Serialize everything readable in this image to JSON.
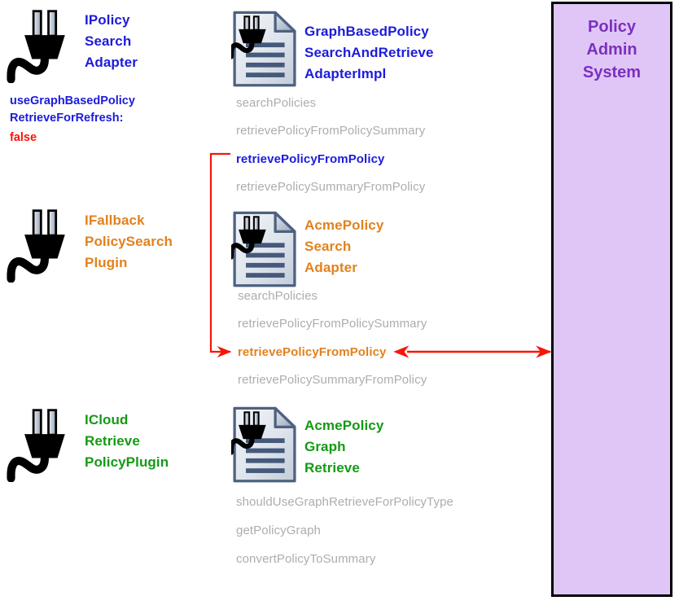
{
  "diagram": {
    "title_text": "Policy Admin System",
    "accent_colors": {
      "blue": "#1c1cdb",
      "orange": "#e2811d",
      "green": "#149a14",
      "gray": "#adadad",
      "red": "#fa1405",
      "purple_text": "#7b2fbe",
      "purple_fill": "#e0c6f7"
    }
  },
  "interfaces": [
    {
      "name": "IPolicy\nSearch\nAdapter",
      "icon": "plug-icon",
      "color": "blue",
      "property_label": "useGraphBasedPolicy\nRetrieveForRefresh:",
      "property_value": "false"
    },
    {
      "name": "IFallback\nPolicySearch\nPlugin",
      "icon": "plug-icon",
      "color": "orange"
    },
    {
      "name": "ICloud\nRetrieve\nPolicyPlugin",
      "icon": "plug-icon",
      "color": "green"
    }
  ],
  "implementations": [
    {
      "name": "GraphBasedPolicy\nSearchAndRetrieve\nAdapterImpl",
      "icon": "document-plug-icon",
      "color": "blue",
      "methods": [
        {
          "label": "searchPolicies",
          "highlight": "none"
        },
        {
          "label": "retrievePolicyFromPolicySummary",
          "highlight": "none"
        },
        {
          "label": "retrievePolicyFromPolicy",
          "highlight": "blue"
        },
        {
          "label": "retrievePolicySummaryFromPolicy",
          "highlight": "none"
        }
      ]
    },
    {
      "name": "AcmePolicy\nSearch\nAdapter",
      "icon": "document-plug-icon",
      "color": "orange",
      "methods": [
        {
          "label": "searchPolicies",
          "highlight": "none"
        },
        {
          "label": "retrievePolicyFromPolicySummary",
          "highlight": "none"
        },
        {
          "label": "retrievePolicyFromPolicy",
          "highlight": "orange"
        },
        {
          "label": "retrievePolicySummaryFromPolicy",
          "highlight": "none"
        }
      ]
    },
    {
      "name": "AcmePolicy\nGraph\nRetrieve",
      "icon": "document-plug-icon",
      "color": "green",
      "methods": [
        {
          "label": "shouldUseGraphRetrieveForPolicyType",
          "highlight": "none"
        },
        {
          "label": "getPolicyGraph",
          "highlight": "none"
        },
        {
          "label": "convertPolicyToSummary",
          "highlight": "none"
        }
      ]
    }
  ],
  "system": {
    "label": "Policy\nAdmin\nSystem"
  },
  "connectors": [
    {
      "name": "delegation-connector",
      "from": "retrievePolicyFromPolicy (GraphBasedPolicySearchAndRetrieveAdapterImpl)",
      "to": "retrievePolicyFromPolicy (AcmePolicySearchAdapter)",
      "style": "elbow",
      "arrow": "end",
      "color": "#fa1405"
    },
    {
      "name": "system-call-connector",
      "from": "retrievePolicyFromPolicy (AcmePolicySearchAdapter)",
      "to": "Policy Admin System",
      "style": "straight",
      "arrow": "both",
      "color": "#fa1405"
    }
  ]
}
